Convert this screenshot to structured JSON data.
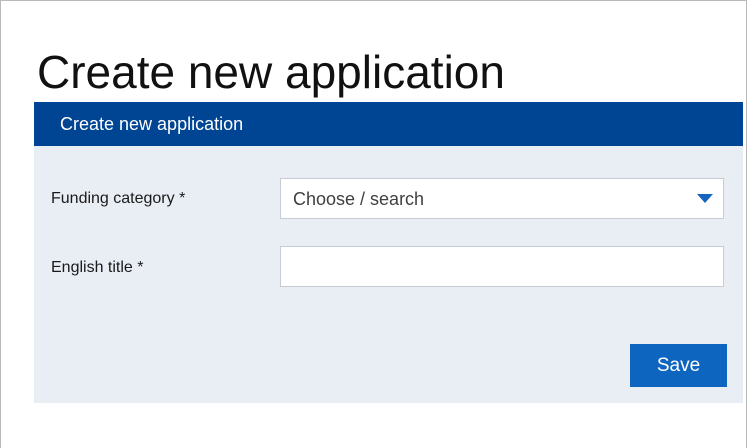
{
  "page": {
    "title": "Create new application"
  },
  "panel": {
    "header": "Create new application",
    "funding_category": {
      "label": "Funding category *",
      "value": "Choose / search"
    },
    "english_title": {
      "label": "English title *",
      "value": ""
    },
    "save_label": "Save"
  },
  "colors": {
    "header_bg": "#004494",
    "panel_bg": "#e9edf4",
    "button_bg": "#0e65c0",
    "caret": "#1565c0"
  },
  "icons": {
    "dropdown": "chevron-down-icon"
  }
}
